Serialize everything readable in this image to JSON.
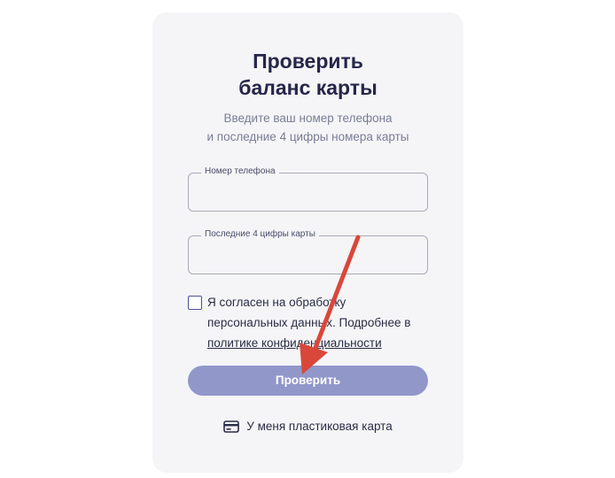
{
  "form": {
    "title_line1": "Проверить",
    "title_line2": "баланс карты",
    "subtitle_line1": "Введите ваш номер телефона",
    "subtitle_line2": "и последние 4 цифры номера карты",
    "phone_label": "Номер телефона",
    "phone_value": "",
    "digits_label": "Последние 4 цифры карты",
    "digits_value": "",
    "consent_text": "Я согласен на обработку персональных данных. Подробнее в ",
    "consent_link": "политике конфиденциальности",
    "consent_checked": false,
    "submit_label": "Проверить",
    "plastic_card_label": "У меня пластиковая карта"
  },
  "icons": {
    "card": "credit-card-icon"
  },
  "colors": {
    "card_bg": "#f5f5f8",
    "title": "#26264a",
    "button": "#9197c9",
    "annotation_arrow": "#d9473a"
  }
}
